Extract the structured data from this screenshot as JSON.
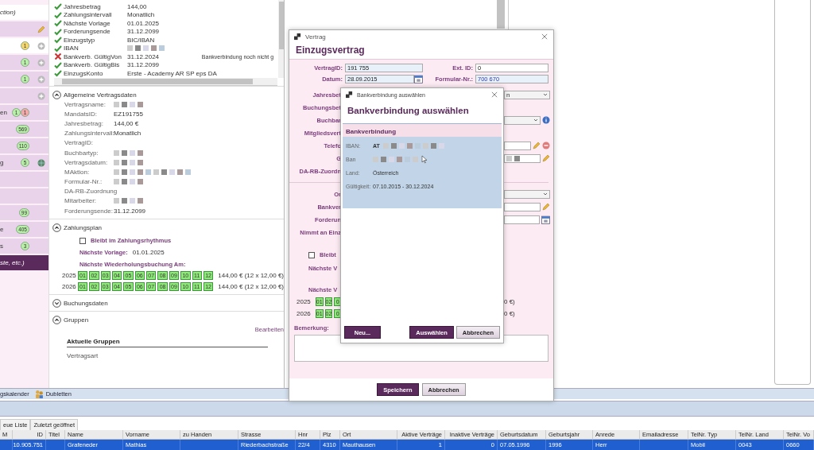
{
  "sidebar": {
    "items": [
      {
        "label": "ction)",
        "kind": "plain",
        "selected": false,
        "highlighted": true
      },
      {
        "kind": "edit",
        "selected": false,
        "highlighted": false
      },
      {
        "badges": [
          {
            "text": "1",
            "color": "#f6d66b"
          }
        ],
        "kind": "add",
        "selected": false,
        "highlighted": true
      },
      {
        "badges": [
          {
            "text": "1",
            "color": "#b9f0a8"
          }
        ],
        "kind": "add",
        "selected": false,
        "highlighted": false
      },
      {
        "badges": [
          {
            "text": "1",
            "color": "#b9f0a8"
          }
        ],
        "kind": "add",
        "selected": false,
        "highlighted": false
      },
      {
        "kind": "add",
        "selected": false,
        "highlighted": false
      },
      {
        "label": "en",
        "badges": [
          {
            "text": "1",
            "color": "#b9f0a8"
          },
          {
            "text": "1",
            "color": "#f5a8a8"
          }
        ],
        "kind": "plain",
        "selected": false,
        "highlighted": false
      },
      {
        "badges": [
          {
            "text": "569",
            "color": "#b9f0a8"
          }
        ],
        "kind": "plain",
        "selected": false,
        "highlighted": false
      },
      {
        "badges": [
          {
            "text": "110",
            "color": "#b9f0a8"
          }
        ],
        "kind": "plain",
        "selected": false,
        "highlighted": false
      },
      {
        "label": "g",
        "badges": [
          {
            "text": "5",
            "color": "#b9f0a8"
          }
        ],
        "kind": "globe",
        "selected": false,
        "highlighted": false
      },
      {
        "kind": "plain",
        "selected": false,
        "highlighted": false
      },
      {
        "kind": "plain",
        "selected": false,
        "highlighted": false
      },
      {
        "badges": [
          {
            "text": "99",
            "color": "#b9f0a8"
          }
        ],
        "kind": "plain",
        "selected": false,
        "highlighted": false
      },
      {
        "label": "e",
        "badges": [
          {
            "text": "405",
            "color": "#b9f0a8"
          }
        ],
        "kind": "plain",
        "selected": false,
        "highlighted": false
      },
      {
        "label": "s",
        "badges": [
          {
            "text": "3",
            "color": "#b9f0a8"
          }
        ],
        "kind": "plain",
        "selected": false,
        "highlighted": false
      },
      {
        "label": "ste, etc.)",
        "kind": "plain",
        "selected": true,
        "highlighted": false
      }
    ]
  },
  "checks": [
    {
      "label": "Jahresbetrag",
      "value": "144,00",
      "ok": true
    },
    {
      "label": "Zahlungsintervall",
      "value": "Monatlich",
      "ok": true
    },
    {
      "label": "Nächste Vorlage",
      "value": "01.01.2025",
      "ok": true
    },
    {
      "label": "Forderungsende",
      "value": "31.12.2099",
      "ok": true
    },
    {
      "label": "Einzugstyp",
      "value": "BIC/IBAN",
      "ok": true
    },
    {
      "label": "IBAN",
      "kind": "blurred",
      "ok": true
    },
    {
      "label": "Bankverb. GültigVon",
      "value": "31.12.2024",
      "note": "Bankverbindung noch nicht g",
      "ok": false
    },
    {
      "label": "Bankverb. GültigBis",
      "value": "31.12.2099",
      "ok": true
    },
    {
      "label": "EinzugsKonto",
      "value": "Erste - Academy AR SP eps DA",
      "ok": true
    }
  ],
  "general": {
    "title": "Allgemeine Vertragsdaten",
    "expanded": true,
    "fields": [
      {
        "label": "Vertragsname:",
        "kind": "blurred"
      },
      {
        "label": "MandatsID:",
        "kind": "text",
        "value": "EZ191755"
      },
      {
        "label": "Jahresbetrag:",
        "kind": "text",
        "value": "144,00 €"
      },
      {
        "label": "Zahlungsintervall:",
        "kind": "text",
        "value": "Monatlich"
      },
      {
        "label": "VertragID:",
        "kind": "empty"
      },
      {
        "label": "Buchbartyp:",
        "kind": "blurred"
      },
      {
        "label": "Vertragsdatum:",
        "kind": "blurred"
      },
      {
        "label": "MAktion:",
        "kind": "blurred"
      },
      {
        "label": "Formular-Nr.:",
        "kind": "blurred"
      },
      {
        "label": "DA-RB-Zuordnung",
        "kind": "empty"
      },
      {
        "label": "Mitarbeiter:",
        "kind": "blurred"
      },
      {
        "label": "Forderungsende:",
        "kind": "text",
        "value": "31.12.2099"
      }
    ]
  },
  "plan": {
    "title": "Zahlungsplan",
    "expanded": true,
    "keep_rhythm": {
      "label": "Bleibt im Zahlungsrhythmus",
      "checked": false
    },
    "next_label": "Nächste Vorlage:",
    "next_value": "01.01.2025",
    "repeat_label": "Nächste Wiederholungsbuchung Am:",
    "years": [
      {
        "year": "2025",
        "total": "144,00 € (12 x 12,00 €)",
        "months": [
          {
            "label": "01",
            "booked": true
          },
          {
            "label": "02",
            "booked": true
          },
          {
            "label": "03",
            "booked": true
          },
          {
            "label": "04",
            "booked": true
          },
          {
            "label": "05",
            "booked": true
          },
          {
            "label": "06",
            "booked": true
          },
          {
            "label": "07",
            "booked": true
          },
          {
            "label": "08",
            "booked": true
          },
          {
            "label": "09",
            "booked": true
          },
          {
            "label": "10",
            "booked": true
          },
          {
            "label": "11",
            "booked": true
          },
          {
            "label": "12",
            "booked": true
          }
        ]
      },
      {
        "year": "2026",
        "total": "144,00 € (12 x 12,00 €)",
        "months": [
          {
            "label": "01",
            "booked": true
          },
          {
            "label": "02",
            "booked": true
          },
          {
            "label": "03",
            "booked": true
          },
          {
            "label": "04",
            "booked": true
          },
          {
            "label": "05",
            "booked": true
          },
          {
            "label": "06",
            "booked": true
          },
          {
            "label": "07",
            "booked": true
          },
          {
            "label": "08",
            "booked": true
          },
          {
            "label": "09",
            "booked": true
          },
          {
            "label": "10",
            "booked": true
          },
          {
            "label": "11",
            "booked": true
          },
          {
            "label": "12",
            "booked": true
          }
        ]
      }
    ]
  },
  "booking": {
    "title": "Buchungsdaten",
    "expanded": false
  },
  "groups": {
    "title": "Gruppen",
    "expanded": true,
    "edit": "Bearbeiten",
    "heading": "Aktuelle Gruppen",
    "items": [
      "Vertragsart"
    ]
  },
  "toolbar": {
    "items": [
      {
        "label": "gskalender",
        "kind": "text"
      },
      {
        "label": "Dubletten",
        "kind": "icon"
      }
    ]
  },
  "list_tabs": [
    {
      "label": "eue Liste",
      "selected": false
    },
    {
      "label": "Zuletzt geöffnet",
      "selected": false
    }
  ],
  "table": {
    "columns": [
      {
        "label": "M",
        "kind": "text"
      },
      {
        "label": "ID",
        "kind": "number"
      },
      {
        "label": "Titel",
        "kind": "text"
      },
      {
        "label": "Name",
        "kind": "text"
      },
      {
        "label": "Vorname",
        "kind": "text"
      },
      {
        "label": "zu Handen",
        "kind": "text"
      },
      {
        "label": "Strasse",
        "kind": "text"
      },
      {
        "label": "Hnr",
        "kind": "text"
      },
      {
        "label": "Plz",
        "kind": "text"
      },
      {
        "label": "Ort",
        "kind": "text"
      },
      {
        "label": "Aktive Verträge",
        "kind": "number"
      },
      {
        "label": "Inaktive Verträge",
        "kind": "number"
      },
      {
        "label": "Geburtsdatum",
        "kind": "text"
      },
      {
        "label": "Geburtsjahr",
        "kind": "text"
      },
      {
        "label": "Anrede",
        "kind": "text"
      },
      {
        "label": "Emailadresse",
        "kind": "text"
      },
      {
        "label": "TelNr. Typ",
        "kind": "text"
      },
      {
        "label": "TelNr. Land",
        "kind": "text"
      },
      {
        "label": "TelNr. Vo",
        "kind": "text"
      }
    ],
    "rows": [
      {
        "selected": true,
        "cells": [
          null,
          "10.905.751",
          null,
          "Grafeneder",
          "Mathias",
          null,
          "Riederbachstraße",
          "22/4",
          "4310",
          "Mauthausen",
          "1",
          "0",
          "07.05.1996",
          "1996",
          "Herr",
          null,
          "Mobil",
          "0043",
          "0660"
        ]
      }
    ]
  },
  "contract_dialog": {
    "title": "Vertrag",
    "heading": "Einzugsvertrag",
    "top_rows": [
      {
        "label": "VertragID:",
        "value": "191 755",
        "label2": "Ext. ID:",
        "value2": "0"
      },
      {
        "label": "Datum:",
        "value": "28.09.2015",
        "label2": "Formular-Nr.:",
        "value2": "700 670"
      }
    ],
    "rows": [
      {
        "label": "Jahresbet",
        "right": {
          "kind": "dropdown",
          "value": "n"
        }
      },
      {
        "label": "Buchungsbet",
        "right": {
          "kind": "empty"
        }
      },
      {
        "label": "Buchbar",
        "right": {
          "kind": "dropdown_info"
        }
      },
      {
        "label": "Mitgliedsvert",
        "right": {
          "kind": "empty"
        }
      },
      {
        "label": "Telefo",
        "right": {
          "kind": "field_edit_delete"
        }
      },
      {
        "label": "G",
        "right": {
          "kind": "field_edit_blurred"
        }
      },
      {
        "label": "DA-RB-Zuordn",
        "right": {
          "kind": "empty"
        }
      }
    ],
    "rows2": [
      {
        "label": "Or",
        "right": {
          "kind": "dropdown"
        }
      },
      {
        "label": "Bankver",
        "right": {
          "kind": "field_edit"
        }
      },
      {
        "label": "Forderun",
        "right": {
          "kind": "field_date"
        }
      },
      {
        "label": "Nimmt an Einz",
        "right": {
          "kind": "empty"
        }
      }
    ],
    "keep_rhythm": {
      "label": "Bleibt",
      "checked": false
    },
    "next_label": "Nächste V",
    "repeat_label": "Nächste V",
    "years": [
      {
        "year": "2025",
        "total": "0 €)",
        "months": [
          {
            "label": "01",
            "booked": true
          },
          {
            "label": "02",
            "booked": true
          },
          {
            "label": "0",
            "booked": true
          }
        ]
      },
      {
        "year": "2026",
        "total": "0 €)",
        "months": [
          {
            "label": "01",
            "booked": true
          },
          {
            "label": "02",
            "booked": true
          },
          {
            "label": "0",
            "booked": true
          }
        ]
      }
    ],
    "remark_label": "Bemerkung:",
    "buttons": [
      {
        "label": "Speichern",
        "kind": "primary"
      },
      {
        "label": "Abbrechen",
        "kind": "secondary"
      }
    ]
  },
  "bank_dialog": {
    "title": "Bankverbindung auswählen",
    "heading": "Bankverbindung auswählen",
    "section": "Bankverbindung",
    "entries": [
      {
        "selected": true,
        "fields": [
          {
            "label": "IBAN:",
            "kind": "blurred",
            "value": "AT"
          },
          {
            "label": "Ban",
            "kind": "blurred"
          },
          {
            "label": "Land:",
            "kind": "text",
            "value": "Österreich"
          },
          {
            "label": "Gültigkeit:",
            "kind": "text",
            "value": "07.10.2015 - 30.12.2024"
          }
        ]
      }
    ],
    "buttons": [
      {
        "label": "Neu...",
        "kind": "primary"
      },
      {
        "label": "Auswählen",
        "kind": "primary"
      },
      {
        "label": "Abbrechen",
        "kind": "secondary"
      }
    ]
  }
}
